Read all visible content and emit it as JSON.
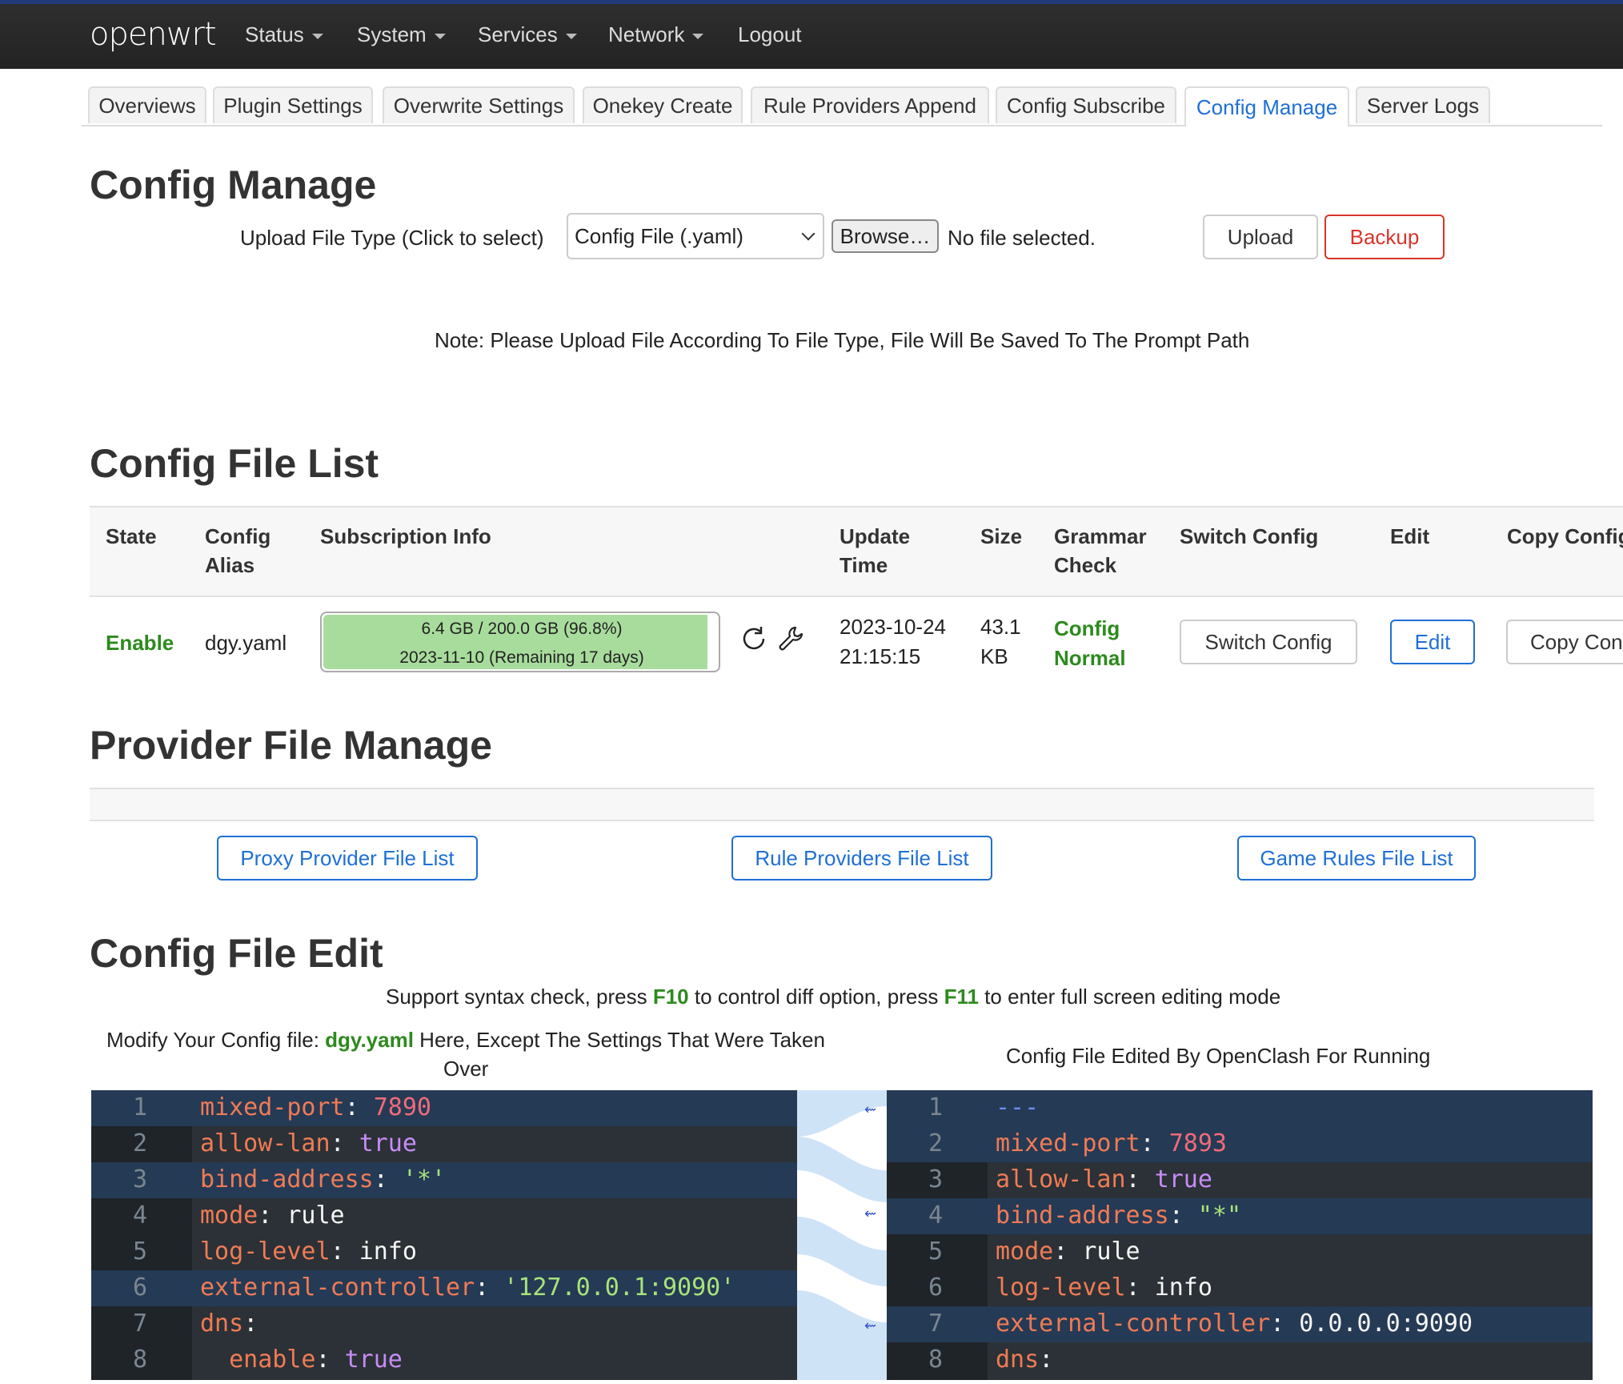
{
  "topbar": {
    "brand": "openwrt",
    "menu": [
      "Status",
      "System",
      "Services",
      "Network",
      "Logout"
    ]
  },
  "tabs": [
    "Overviews",
    "Plugin Settings",
    "Overwrite Settings",
    "Onekey Create",
    "Rule Providers Append",
    "Config Subscribe",
    "Config Manage",
    "Server Logs"
  ],
  "config_manage": {
    "title": "Config Manage",
    "upload_label": "Upload File Type (Click to select)",
    "file_type": "Config File (.yaml)",
    "browse": "Browse…",
    "no_file": "No file selected.",
    "upload": "Upload",
    "backup": "Backup",
    "note": "Note: Please Upload File According To File Type, File Will Be Saved To The Prompt Path"
  },
  "file_list": {
    "title": "Config File List",
    "headers": {
      "state": "State",
      "alias1": "Config",
      "alias2": "Alias",
      "sub": "Subscription Info",
      "update1": "Update",
      "update2": "Time",
      "size": "Size",
      "grammar1": "Grammar",
      "grammar2": "Check",
      "switch": "Switch Config",
      "edit": "Edit",
      "copy": "Copy Config"
    },
    "row": {
      "state": "Enable",
      "alias": "dgy.yaml",
      "usage": "6.4 GB / 200.0 GB (96.8%)",
      "expire": "2023-11-10 (Remaining 17 days)",
      "usage_fraction": 0.968,
      "date": "2023-10-24",
      "time": "21:15:15",
      "size_num": "43.1",
      "size_unit": "KB",
      "grammar1": "Config",
      "grammar2": "Normal",
      "switch_btn": "Switch Config",
      "edit_btn": "Edit",
      "copy_btn": "Copy Con"
    }
  },
  "provider": {
    "title": "Provider File Manage",
    "proxy": "Proxy Provider File List",
    "rule": "Rule Providers File List",
    "game": "Game Rules File List"
  },
  "edit": {
    "title": "Config File Edit",
    "help_a": "Support syntax check, press ",
    "f10": "F10",
    "help_b": " to control diff option, press ",
    "f11": "F11",
    "help_c": " to enter full screen editing mode",
    "left_a": "Modify Your Config file: ",
    "left_file": "dgy.yaml",
    "left_b": " Here, Except The Settings That Were Taken",
    "left_c": "Over",
    "right": "Config File Edited By OpenClash For Running",
    "left_lines": [
      {
        "n": "1",
        "k": "mixed-port",
        "v": "7890",
        "t": "n"
      },
      {
        "n": "2",
        "k": "allow-lan",
        "v": "true",
        "t": "b"
      },
      {
        "n": "3",
        "k": "bind-address",
        "v": "'*'",
        "t": "s"
      },
      {
        "n": "4",
        "k": "mode",
        "v": "rule",
        "t": "p"
      },
      {
        "n": "5",
        "k": "log-level",
        "v": "info",
        "t": "p"
      },
      {
        "n": "6",
        "k": "external-controller",
        "v": "'127.0.0.1:9090'",
        "t": "s"
      },
      {
        "n": "7",
        "k": "dns",
        "v": "",
        "t": "p"
      },
      {
        "n": "8",
        "k": "  enable",
        "v": "true",
        "t": "b"
      }
    ],
    "right_lines": [
      {
        "n": "1",
        "k": "",
        "v": "---",
        "t": "d"
      },
      {
        "n": "2",
        "k": "mixed-port",
        "v": "7893",
        "t": "n"
      },
      {
        "n": "3",
        "k": "allow-lan",
        "v": "true",
        "t": "b"
      },
      {
        "n": "4",
        "k": "bind-address",
        "v": "\"*\"",
        "t": "s"
      },
      {
        "n": "5",
        "k": "mode",
        "v": "rule",
        "t": "p"
      },
      {
        "n": "6",
        "k": "log-level",
        "v": "info",
        "t": "p"
      },
      {
        "n": "7",
        "k": "external-controller",
        "v": "0.0.0.0:9090",
        "t": "p"
      },
      {
        "n": "8",
        "k": "dns",
        "v": "",
        "t": "p"
      }
    ]
  }
}
